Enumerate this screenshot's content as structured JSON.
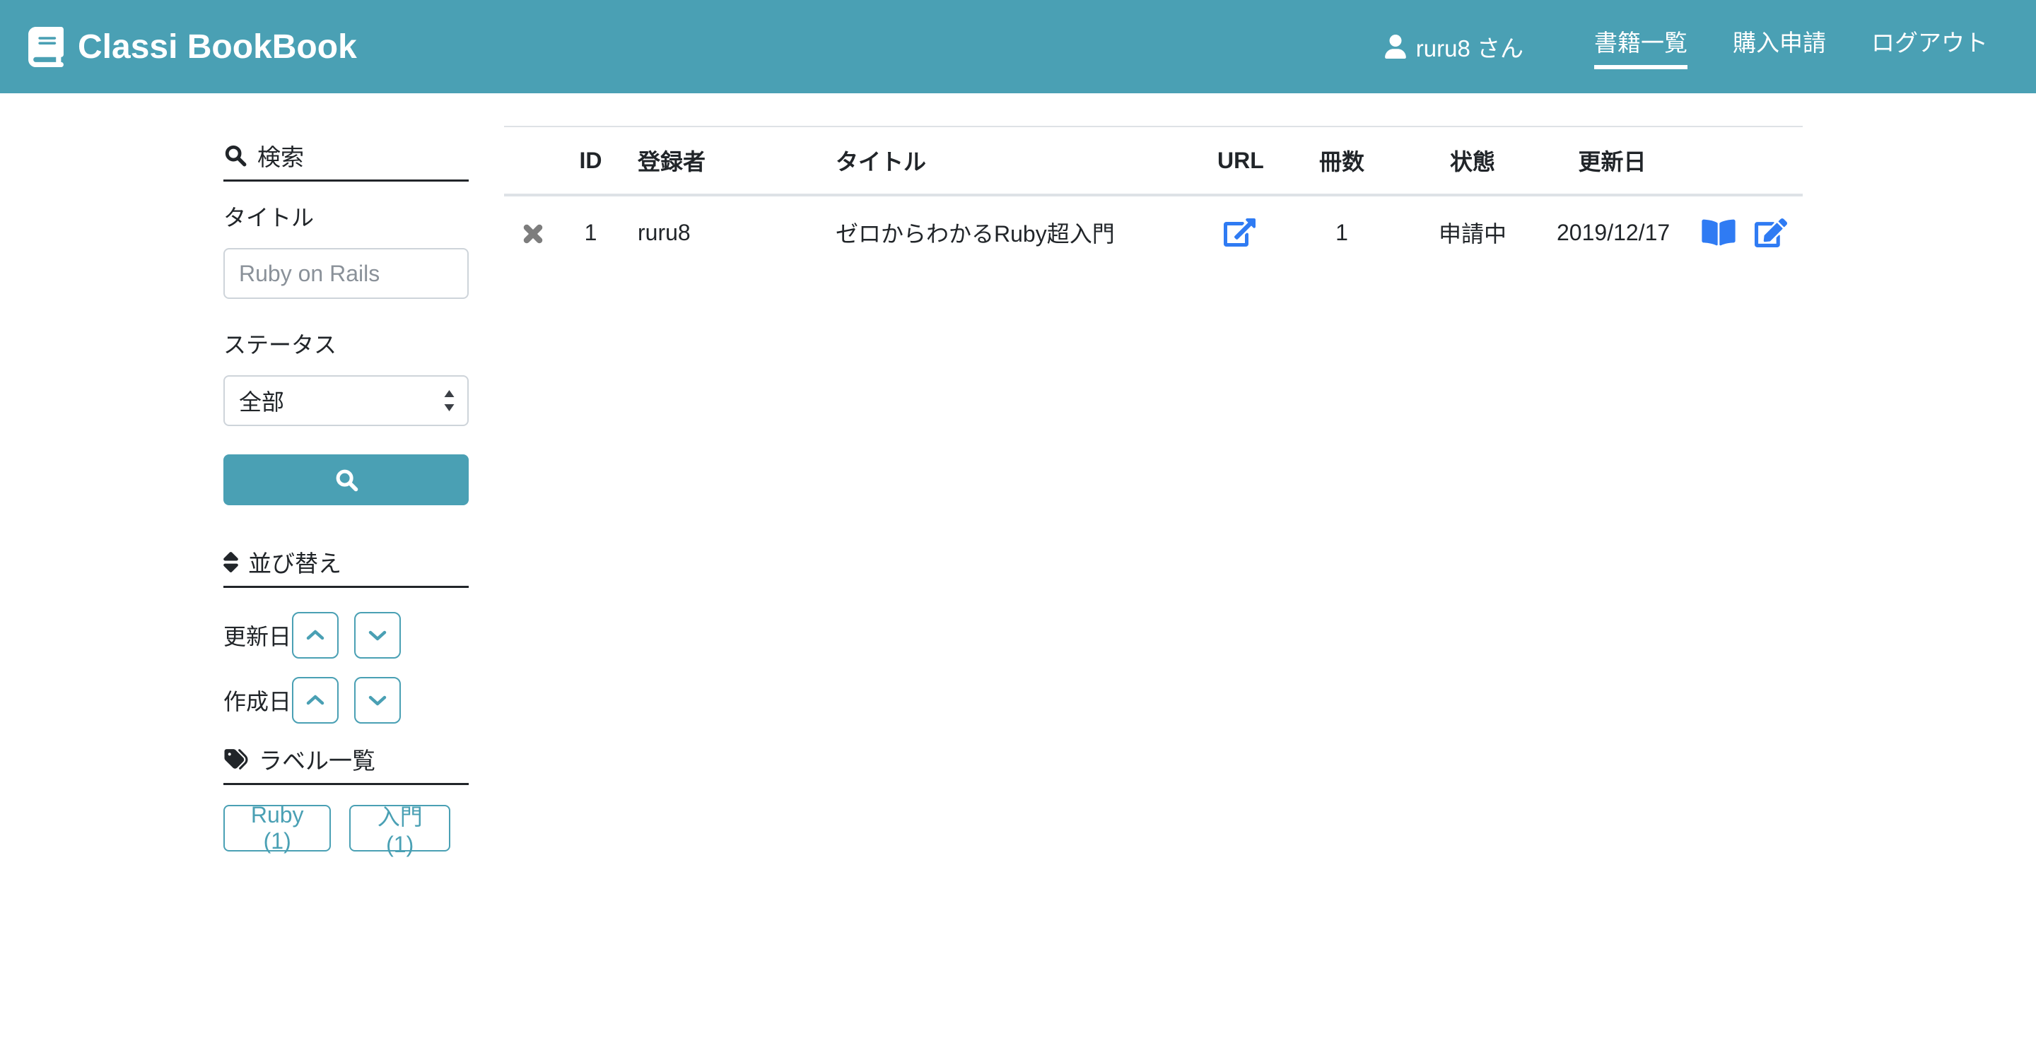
{
  "navbar": {
    "brand": "Classi BookBook",
    "user_name": "ruru8 さん",
    "items": [
      {
        "label": "書籍一覧",
        "active": true
      },
      {
        "label": "購入申請",
        "active": false
      },
      {
        "label": "ログアウト",
        "active": false
      }
    ]
  },
  "sidebar": {
    "search_heading": "検索",
    "title_label": "タイトル",
    "title_value": "",
    "title_placeholder": "Ruby on Rails",
    "status_label": "ステータス",
    "status_value": "全部",
    "sort_heading": "並び替え",
    "sort_rows": [
      {
        "label": "更新日"
      },
      {
        "label": "作成日"
      }
    ],
    "labels_heading": "ラベル一覧",
    "labels": [
      "Ruby (1)",
      "入門 (1)"
    ]
  },
  "table": {
    "headers": [
      "ID",
      "登録者",
      "タイトル",
      "URL",
      "冊数",
      "状態",
      "更新日"
    ],
    "rows": [
      {
        "id": "1",
        "registrant": "ruru8",
        "title": "ゼロからわかるRuby超入門",
        "count": "1",
        "status": "申請中",
        "updated": "2019/12/17"
      }
    ]
  },
  "colors": {
    "navbar_bg": "#4aa0b4",
    "accent_teal": "#4aa0b4",
    "action_icon_blue": "#2f7bf3",
    "delete_icon_grey": "#7d7d7d",
    "table_border": "#dee2e6",
    "heading_underline": "#212529",
    "placeholder_grey": "#8a9199"
  },
  "icons": {
    "brand": "book-icon",
    "user": "user-icon",
    "search_heading": "search-icon",
    "search_button": "search-icon",
    "sort_heading": "sort-icon",
    "labels_heading": "tags-icon",
    "select_arrows": "select-spinner-icon",
    "sort_up": "chevron-up-icon",
    "sort_down": "chevron-down-icon",
    "row_delete": "times-icon",
    "row_url": "external-link-icon",
    "row_book": "book-open-icon",
    "row_edit": "edit-pencil-icon"
  }
}
